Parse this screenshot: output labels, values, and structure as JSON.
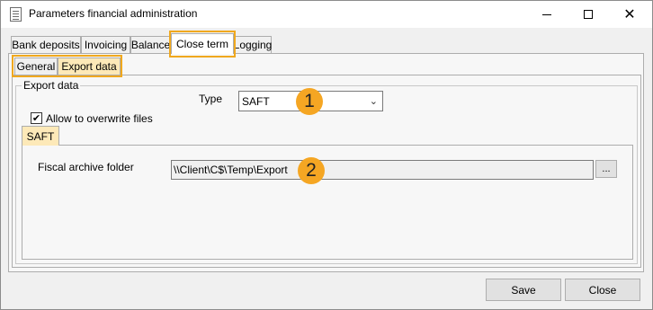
{
  "window": {
    "title": "Parameters financial administration",
    "icon": "document-icon",
    "controls": {
      "minimize": "minimize-icon",
      "maximize": "maximize-icon",
      "close": "close-icon"
    }
  },
  "tabs": [
    {
      "label": "Bank deposits"
    },
    {
      "label": "Invoicing"
    },
    {
      "label": "Balance"
    },
    {
      "label": "Close term",
      "active": true
    },
    {
      "label": "Logging"
    }
  ],
  "subtabs": [
    {
      "label": "General"
    },
    {
      "label": "Export data",
      "active": true
    }
  ],
  "export_group": {
    "legend": "Export data",
    "type_label": "Type",
    "type_value": "SAFT",
    "overwrite_label": "Allow to overwrite files",
    "overwrite_checked": true
  },
  "saft": {
    "tab_label": "SAFT",
    "folder_label": "Fiscal archive folder",
    "folder_value": "\\\\Client\\C$\\Temp\\Export",
    "browse_label": "..."
  },
  "badges": {
    "one": "1",
    "two": "2"
  },
  "footer": {
    "save": "Save",
    "close": "Close"
  },
  "colors": {
    "highlight": "#f0a81e",
    "badge": "#f5a623",
    "active_subtab": "#fde9b8"
  }
}
